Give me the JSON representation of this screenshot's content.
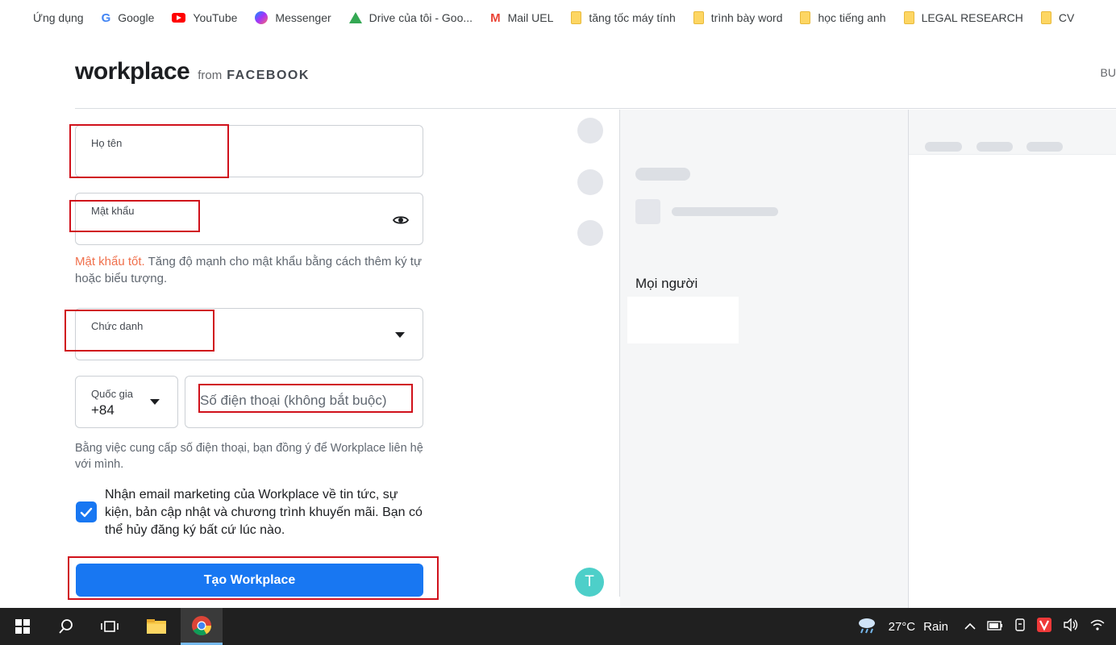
{
  "bookmarks": [
    {
      "label": "Ứng dụng",
      "icon": "apps-grid-icon"
    },
    {
      "label": "Google",
      "icon": "google-icon"
    },
    {
      "label": "YouTube",
      "icon": "youtube-icon"
    },
    {
      "label": "Messenger",
      "icon": "messenger-icon"
    },
    {
      "label": "Drive của tôi - Goo...",
      "icon": "google-drive-icon"
    },
    {
      "label": "Mail UEL",
      "icon": "gmail-icon"
    },
    {
      "label": "tăng tốc máy tính",
      "icon": "folder-icon"
    },
    {
      "label": "trình bày word",
      "icon": "folder-icon"
    },
    {
      "label": "học tiếng anh",
      "icon": "folder-icon"
    },
    {
      "label": "LEGAL RESEARCH",
      "icon": "folder-icon"
    },
    {
      "label": "CV",
      "icon": "folder-icon"
    }
  ],
  "header": {
    "logo_word": "workplace",
    "logo_from": "from",
    "logo_brand": "FACEBOOK",
    "right_text": "BU"
  },
  "form": {
    "fullname_label": "Họ tên",
    "password_label": "Mật khẩu",
    "password_strength": "Mật khẩu tốt.",
    "password_hint": " Tăng độ mạnh cho mật khẩu bằng cách thêm ký tự hoặc biểu tượng.",
    "jobtitle_label": "Chức danh",
    "country_label": "Quốc gia",
    "country_code": "+84",
    "phone_placeholder": "Số điện thoại (không bắt buộc)",
    "phone_consent": "Bằng việc cung cấp số điện thoại, bạn đồng ý để Workplace liên hệ với mình.",
    "marketing_checked": true,
    "marketing_text": "Nhận email marketing của Workplace về tin tức, sự kiện, bản cập nhật và chương trình khuyến mãi. Bạn có thể hủy đăng ký bất cứ lúc nào.",
    "submit_label": "Tạo Workplace"
  },
  "preview": {
    "people_title": "Mọi người",
    "avatar_letter": "T"
  },
  "taskbar": {
    "weather_temp": "27°C",
    "weather_text": "Rain"
  },
  "colors": {
    "brand_blue": "#1877f2",
    "annotation_red": "#d0111b",
    "strength_orange": "#f0704c"
  }
}
